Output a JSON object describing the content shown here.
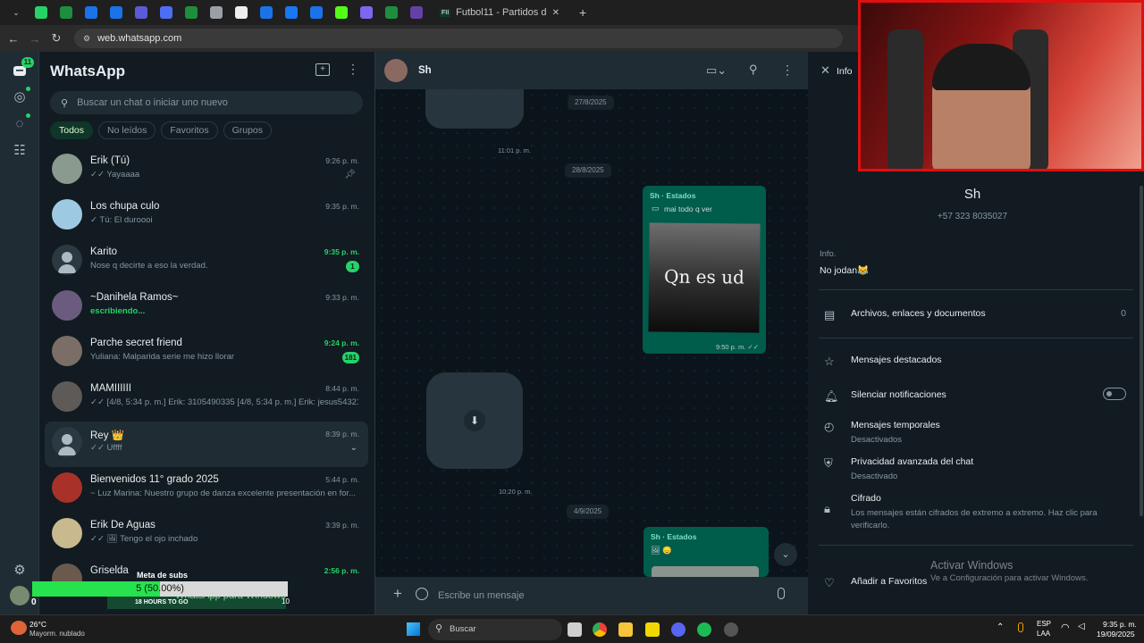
{
  "browser": {
    "tabs": [
      {
        "icon": "whatsapp-icon",
        "color": "#25d366"
      },
      {
        "icon": "sheets-icon",
        "color": "#1e8e3e"
      },
      {
        "icon": "site-icon",
        "color": "#1a73e8"
      },
      {
        "icon": "site-icon",
        "color": "#1a73e8"
      },
      {
        "icon": "video-icon",
        "color": "#5b5bd6"
      },
      {
        "icon": "shield-icon",
        "color": "#4c6ef5"
      },
      {
        "icon": "sheets-icon",
        "color": "#1e8e3e"
      },
      {
        "icon": "gear-icon",
        "color": "#9aa0a6"
      },
      {
        "icon": "tiktok-icon",
        "color": "#eeeeee"
      },
      {
        "icon": "site-icon",
        "color": "#1a73e8"
      },
      {
        "icon": "facebook-icon",
        "color": "#1877f2"
      },
      {
        "icon": "site-icon",
        "color": "#1a73e8"
      },
      {
        "icon": "kick-icon",
        "color": "#53fc18"
      },
      {
        "icon": "link-icon",
        "color": "#7b68ee"
      },
      {
        "icon": "edit-icon",
        "color": "#1e8e3e"
      },
      {
        "icon": "stream-icon",
        "color": "#6441a5"
      }
    ],
    "active_tab": {
      "icon_text": "FII",
      "title": "Futbol11 - Partidos de fútbol d",
      "close": "✕"
    },
    "new_tab": "+",
    "url": "web.whatsapp.com"
  },
  "rail": {
    "chats_badge": "11"
  },
  "sidebar": {
    "title": "WhatsApp",
    "search_placeholder": "Buscar un chat o iniciar uno nuevo",
    "filters": [
      "Todos",
      "No leídos",
      "Favoritos",
      "Grupos"
    ],
    "chats": [
      {
        "name": "Erik (Tú)",
        "preview": "✓✓ Yayaaaa",
        "time": "9:26 p. m.",
        "pinned": true,
        "avatar": "photo",
        "color": "#8a9a8e"
      },
      {
        "name": "Los chupa culo",
        "preview": "✓ Tú: El duroooi",
        "time": "9:35 p. m.",
        "avatar": "photo",
        "color": "#9ec9e2"
      },
      {
        "name": "Karito",
        "preview": "Nose q decirte a eso la verdad.",
        "time": "9:35 p. m.",
        "time_green": true,
        "unread": "1",
        "avatar": "default"
      },
      {
        "name": "~Danihela Ramos~",
        "preview": "escribiendo...",
        "typing": true,
        "time": "9:33 p. m.",
        "avatar": "photo",
        "color": "#6b5b7e"
      },
      {
        "name": "Parche secret friend",
        "preview": "Yuliana: Malparida serie me hizo llorar",
        "time": "9:24 p. m.",
        "time_green": true,
        "unread": "181",
        "avatar": "photo",
        "color": "#7a6e66"
      },
      {
        "name": "MAMIIIIII",
        "preview": "✓✓ [4/8, 5:34 p. m.] Erik: 3105490335 [4/8, 5:34 p. m.] Erik: jesus54321#",
        "time": "8:44 p. m.",
        "avatar": "photo",
        "color": "#5e5a57"
      },
      {
        "name": "Rey 👑",
        "preview": "✓✓ Uffff",
        "time": "8:39 p. m.",
        "avatar": "default",
        "highlight": true
      },
      {
        "name": "Bienvenidos 11° grado 2025",
        "preview": "~ Luz Marina: Nuestro grupo de danza excelente presentación en for...",
        "time": "5:44 p. m.",
        "avatar": "photo",
        "color": "#a8322a"
      },
      {
        "name": "Erik De Aguas",
        "preview": "✓✓ 🖼 Tengo el ojo inchado",
        "time": "3:39 p. m.",
        "avatar": "photo",
        "color": "#c9b98e"
      },
      {
        "name": "Griselda",
        "preview": "",
        "time": "2:56 p. m.",
        "time_green": true,
        "avatar": "photo",
        "color": "#6a5a4e"
      }
    ]
  },
  "conversation": {
    "contact_name": "Sh",
    "dates": [
      "27/8/2025",
      "28/8/2025",
      "4/9/2025"
    ],
    "times": [
      "11:01 p. m.",
      "10:20 p. m."
    ],
    "status_reply_1": {
      "from": "Sh · Estados",
      "subtitle": "mai todo q ver",
      "image_text": "Qn es ud",
      "time": "9:50 p. m. ✓✓"
    },
    "status_reply_2": {
      "from": "Sh · Estados",
      "subtitle": "🖼 😞"
    },
    "input_placeholder": "Escribe un mensaje"
  },
  "info": {
    "close_label": "Info",
    "name": "Sh",
    "phone": "+57 323 8035027",
    "about_label": "Info.",
    "about_text": "No jodan😹",
    "files_label": "Archivos, enlaces y documentos",
    "files_count": "0",
    "starred_label": "Mensajes destacados",
    "mute_label": "Silenciar notificaciones",
    "temp_label": "Mensajes temporales",
    "temp_value": "Desactivados",
    "privacy_label": "Privacidad avanzada del chat",
    "privacy_value": "Desactivado",
    "encryption_label": "Cifrado",
    "encryption_text": "Los mensajes están cifrados de extremo a extremo. Haz clic para verificarlo.",
    "favorites_label": "Añadir a Favoritos"
  },
  "watermark": {
    "title": "Activar Windows",
    "subtitle": "Ve a Configuración para activar Windows."
  },
  "stream_overlay": {
    "goal_label": "Meta de subs",
    "goal_text": "5 (50.00%)",
    "goal_progress": 0.5,
    "goal_min": "0",
    "goal_max": "10",
    "promo_text": "WhatsApp para Windows",
    "promo_sub": "18 HOURS TO GO"
  },
  "taskbar": {
    "weather_temp": "26°C",
    "weather_desc": "Mayorm. nublado",
    "search_placeholder": "Buscar",
    "lang1": "ESP",
    "lang2": "LAA",
    "time": "9:35 p. m.",
    "date": "19/09/2025"
  }
}
